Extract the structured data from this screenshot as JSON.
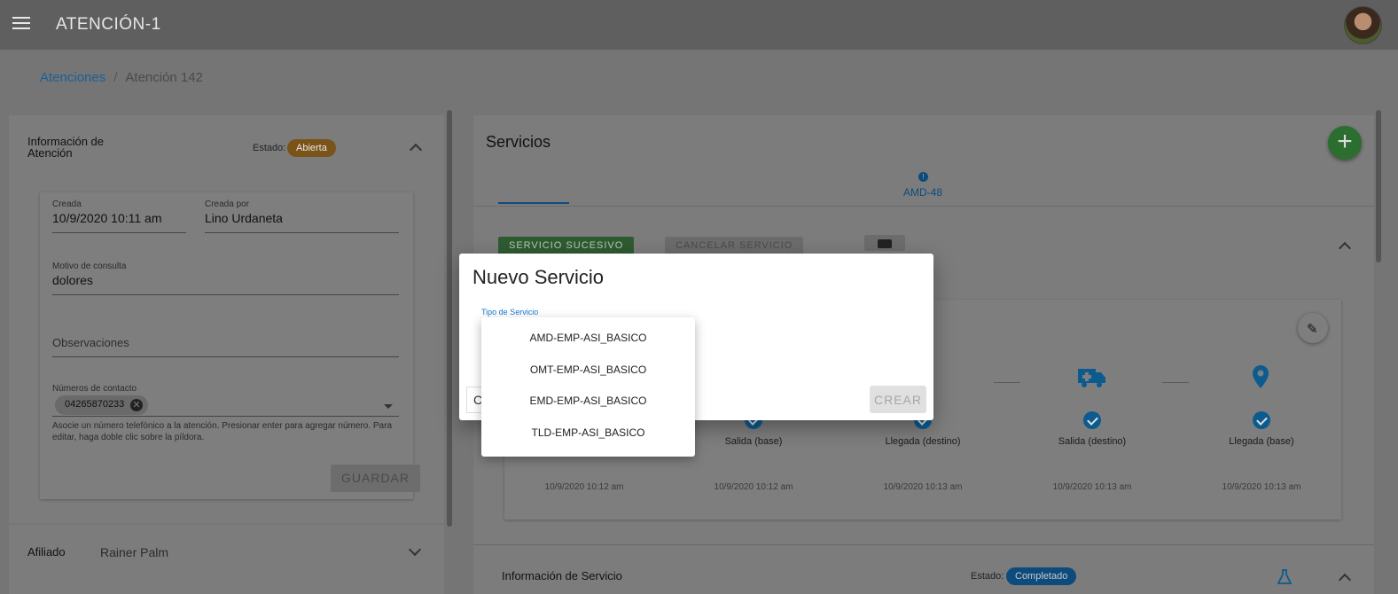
{
  "app_title": "ATENCIÓN-1",
  "breadcrumb": {
    "root": "Atenciones",
    "separator": "/",
    "current": "Atención 142"
  },
  "info_panel": {
    "title": "Información de Atención",
    "status_label": "Estado:",
    "status_value": "Abierta",
    "created_label": "Creada",
    "created_value": "10/9/2020 10:11 am",
    "created_by_label": "Creada por",
    "created_by_value": "Lino Urdaneta",
    "reason_label": "Motivo de consulta",
    "reason_value": "dolores",
    "observations_placeholder": "Observaciones",
    "contacts_label": "Números de contacto",
    "contact_chip": "04265870233",
    "contacts_hint": "Asocie un número telefónico a la atención. Presionar enter para agregar número. Para editar, haga doble clic sobre la píldora.",
    "save_label": "GUARDAR"
  },
  "affiliate": {
    "label": "Afiliado",
    "value": "Rainer Palm"
  },
  "services": {
    "title": "Servicios",
    "tab_label": "AMD-48",
    "successive_label": "SERVICIO SUCESIVO",
    "cancel_service_label": "CANCELAR SERVICIO",
    "steps": [
      {
        "label": "",
        "time": "10/9/2020 10:12 am"
      },
      {
        "label": "Salida (base)",
        "time": "10/9/2020 10:12 am"
      },
      {
        "label": "Llegada (destino)",
        "time": "10/9/2020 10:13 am"
      },
      {
        "label": "Salida (destino)",
        "time": "10/9/2020 10:13 am"
      },
      {
        "label": "Llegada (base)",
        "time": "10/9/2020 10:13 am"
      }
    ],
    "info_title": "Información de Servicio",
    "info_status_label": "Estado:",
    "info_status_value": "Completado"
  },
  "dialog": {
    "title": "Nuevo Servicio",
    "field_label": "Tipo de Servicio",
    "cancel_fragment": "C",
    "create_label": "CREAR",
    "options": [
      "AMD-EMP-ASI_BASICO",
      "OMT-EMP-ASI_BASICO",
      "EMD-EMP-ASI_BASICO",
      "TLD-EMP-ASI_BASICO"
    ]
  },
  "colors": {
    "status_open": "#ef9a1a",
    "status_done": "#1e88e5",
    "fab": "#43a047",
    "link": "#1976d2"
  }
}
